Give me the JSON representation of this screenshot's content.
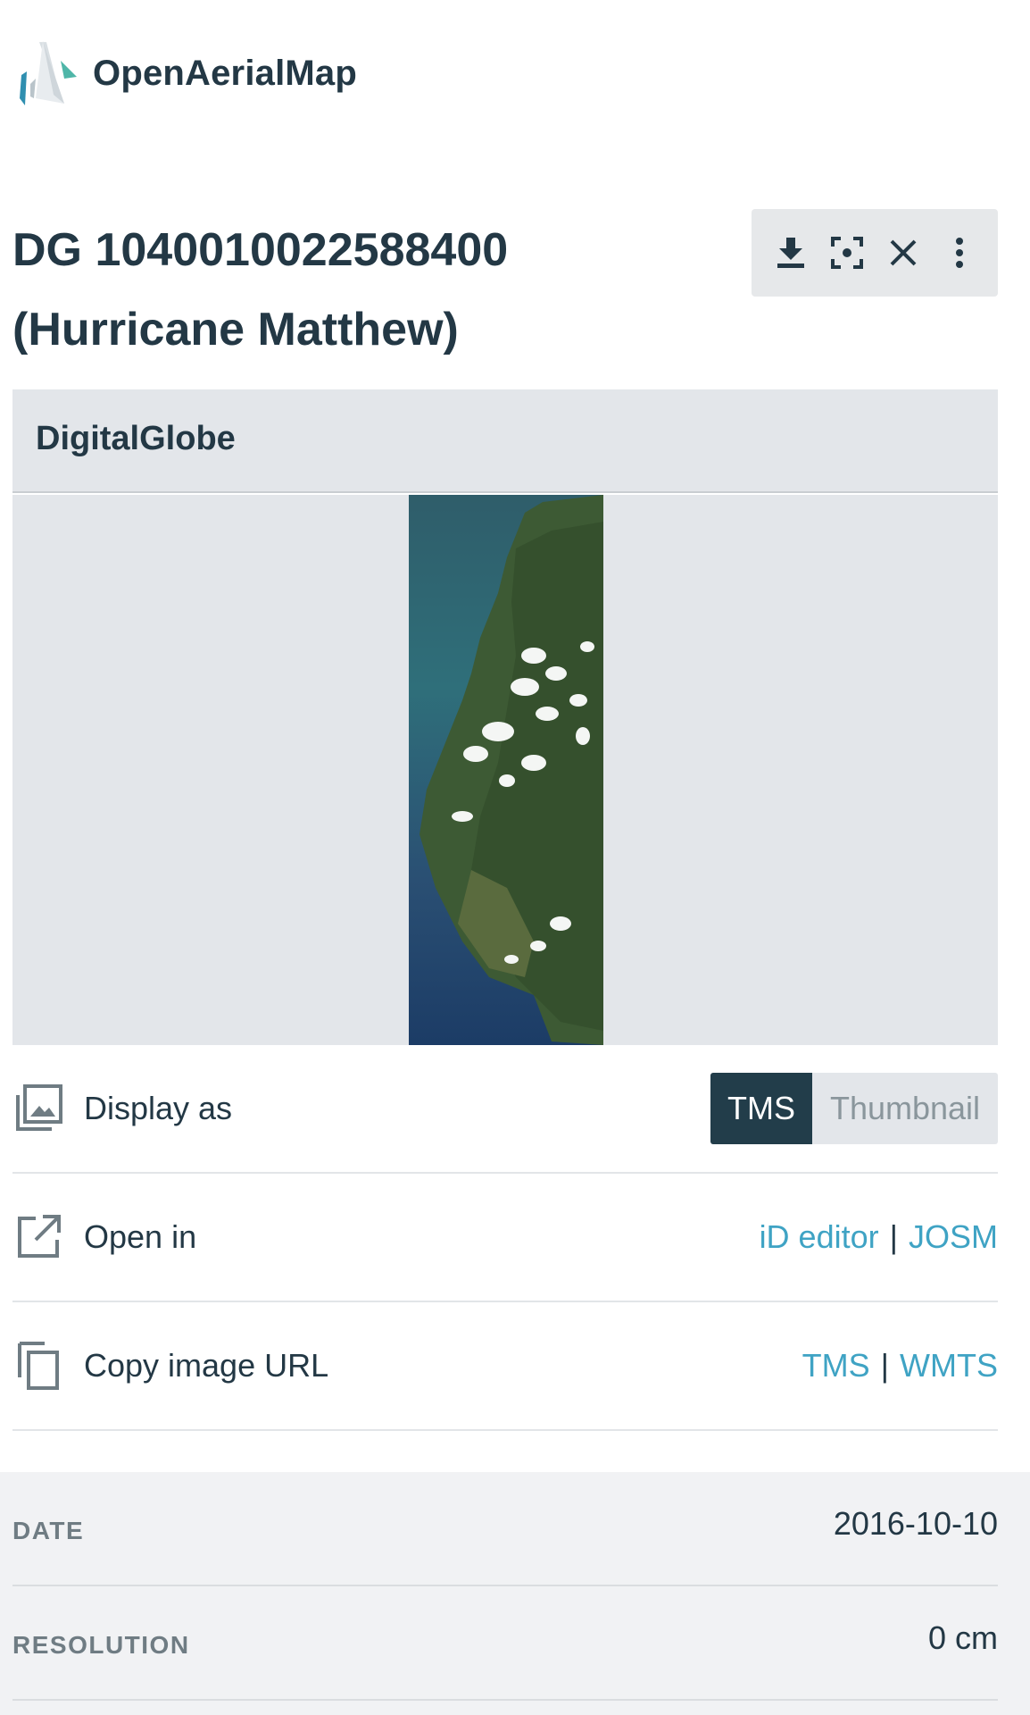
{
  "app": {
    "name": "OpenAerialMap"
  },
  "image": {
    "title_line1": "DG 1040010022588400",
    "title_line2": "(Hurricane Matthew)",
    "provider": "DigitalGlobe"
  },
  "toolbar": {
    "icons": [
      "download-icon",
      "focus-icon",
      "close-icon",
      "more-vertical-icon"
    ]
  },
  "options": {
    "display_as": {
      "label": "Display as",
      "choices": [
        "TMS",
        "Thumbnail"
      ],
      "selected": "TMS"
    },
    "open_in": {
      "label": "Open in",
      "links": [
        "iD editor",
        "JOSM"
      ],
      "separator": "|"
    },
    "copy_url": {
      "label": "Copy image URL",
      "links": [
        "TMS",
        "WMTS"
      ],
      "separator": "|"
    }
  },
  "meta": {
    "date_label": "DATE",
    "date": "2016-10-10",
    "resolution_label": "RESOLUTION",
    "resolution": "0 cm"
  },
  "colors": {
    "primary": "#223d4a",
    "link": "#3fa3c4",
    "panel": "#e3e6ea"
  }
}
